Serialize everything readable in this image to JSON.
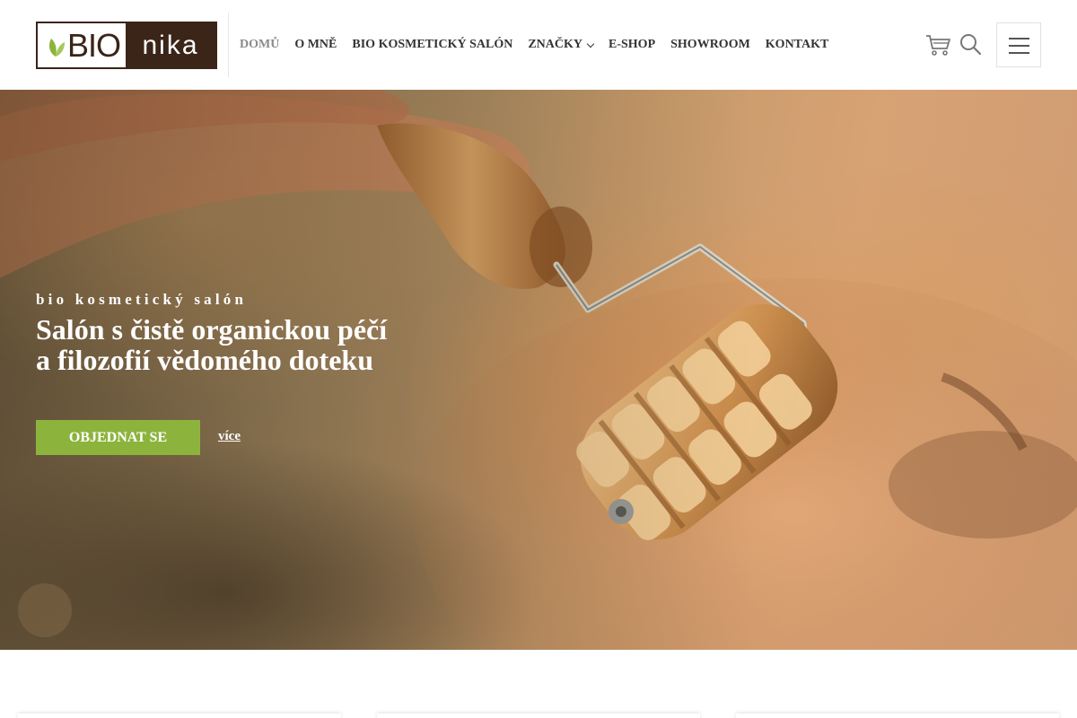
{
  "brand": {
    "logo_left_text": "BIO",
    "logo_right_text": "nika",
    "colors": {
      "brown": "#3b2418",
      "leaf_green": "#8cb43d",
      "accent_green": "#8cb43d"
    }
  },
  "nav": {
    "items": [
      {
        "label": "DOMŮ",
        "active": true
      },
      {
        "label": "O MNĚ"
      },
      {
        "label": "BIO KOSMETICKÝ SALÓN"
      },
      {
        "label": "ZNAČKY",
        "has_dropdown": true
      },
      {
        "label": "E-SHOP"
      },
      {
        "label": "SHOWROOM"
      },
      {
        "label": "KONTAKT"
      }
    ],
    "icons": [
      "cart-icon",
      "search-icon",
      "hamburger-menu-icon"
    ]
  },
  "hero": {
    "kicker": "bio kosmetický salón",
    "title_line1": "Salón s čistě organickou péčí",
    "title_line2": "a filozofií vědomého doteku",
    "cta_label": "OBJEDNAT SE",
    "more_label": "více",
    "image": "wooden-massage-roller-on-face-photo"
  },
  "cards": {
    "count": 3
  }
}
